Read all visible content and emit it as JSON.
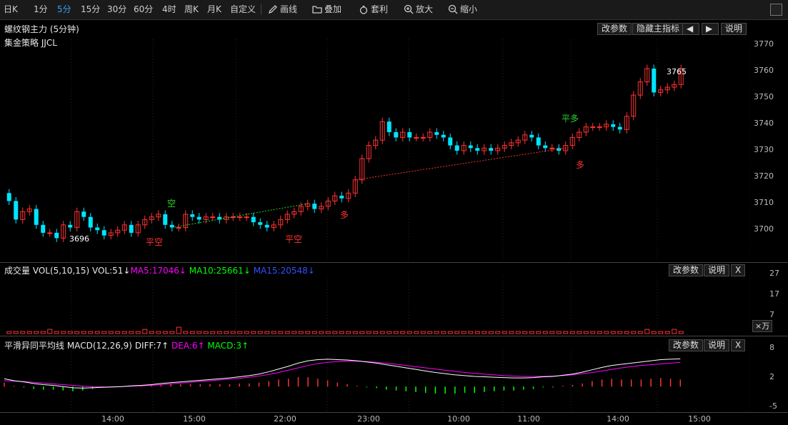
{
  "toolbar": {
    "periods": [
      "日K",
      "1分",
      "5分",
      "15分",
      "30分",
      "60分",
      "4时",
      "周K",
      "月K",
      "自定义"
    ],
    "active_period": "5分",
    "tools": [
      "画线",
      "叠加",
      "套利",
      "放大",
      "缩小"
    ]
  },
  "main_chart": {
    "title": "螺纹钢主力 (5分钟)",
    "subtitle": "集金策略 JJCL",
    "buttons": [
      "改参数",
      "隐藏主指标",
      "◀",
      "▶",
      "说明"
    ],
    "y_ticks": [
      "3770",
      "3760",
      "3750",
      "3740",
      "3730",
      "3720",
      "3710",
      "3700"
    ],
    "annotations": {
      "high": "3765",
      "low": "3696",
      "short": "空",
      "close_short_1": "平空",
      "close_short_2": "平空",
      "long_1": "多",
      "long_2": "多",
      "close_long": "平多"
    }
  },
  "volume_panel": {
    "title": "成交量",
    "indicator": "VOL(5,10,15)",
    "vol": "VOL:51↓",
    "ma5": "MA5:17046↓",
    "ma10": "MA10:25661↓",
    "ma15": "MA15:20548↓",
    "buttons": [
      "改参数",
      "说明",
      "X"
    ],
    "y_ticks": [
      "27",
      "17",
      "7"
    ],
    "unit": "×万"
  },
  "macd_panel": {
    "title": "平滑异同平均线",
    "indicator": "MACD(12,26,9)",
    "diff": "DIFF:7↑",
    "dea": "DEA:6↑",
    "macd": "MACD:3↑",
    "buttons": [
      "改参数",
      "说明",
      "X"
    ],
    "y_ticks": [
      "8",
      "2",
      "-5"
    ]
  },
  "x_axis": [
    "14:00",
    "15:00",
    "22:00",
    "23:00",
    "10:00",
    "11:00",
    "14:00",
    "15:00"
  ],
  "colors": {
    "up": "#ff3232",
    "down": "#00e5ff",
    "ma5": "#ff00ff",
    "ma10": "#00ff00",
    "ma15": "#3050ff",
    "diff": "#ffffff",
    "dea": "#ff00ff",
    "accent": "#3aa0ff"
  },
  "chart_data": {
    "type": "candlestick",
    "ylim": [
      3690,
      3772
    ],
    "closes": [
      3712,
      3705,
      3708,
      3709,
      3703,
      3700,
      3700,
      3698,
      3703,
      3702,
      3708,
      3706,
      3702,
      3701,
      3699,
      3700,
      3701,
      3703,
      3700,
      3703,
      3705,
      3706,
      3707,
      3703,
      3702,
      3702,
      3707,
      3706,
      3705,
      3706,
      3706,
      3705,
      3706,
      3706,
      3706,
      3706,
      3704,
      3703,
      3702,
      3703,
      3705,
      3707,
      3708,
      3710,
      3711,
      3709,
      3710,
      3712,
      3714,
      3713,
      3715,
      3720,
      3728,
      3733,
      3735,
      3742,
      3738,
      3736,
      3738,
      3736,
      3736,
      3736,
      3738,
      3737,
      3736,
      3733,
      3731,
      3733,
      3732,
      3731,
      3732,
      3731,
      3732,
      3733,
      3734,
      3735,
      3737,
      3736,
      3733,
      3732,
      3732,
      3731,
      3733,
      3736,
      3738,
      3740,
      3740,
      3740,
      3741,
      3740,
      3739,
      3744,
      3752,
      3757,
      3762,
      3753,
      3754,
      3755,
      3756,
      3762
    ],
    "volume_ylim": [
      0,
      27
    ],
    "volume": [
      1,
      1,
      1,
      1,
      1,
      1,
      2,
      1,
      1,
      1,
      1,
      1,
      1,
      1,
      1,
      1,
      1,
      1,
      1,
      1,
      2,
      1,
      1,
      1,
      1,
      3,
      1,
      1,
      1,
      1,
      1,
      1,
      1,
      1,
      1,
      1,
      1,
      1,
      1,
      1,
      1,
      1,
      1,
      1,
      1,
      1,
      1,
      1,
      1,
      1,
      1,
      1,
      1,
      1,
      1,
      1,
      1,
      1,
      1,
      1,
      1,
      1,
      1,
      1,
      1,
      1,
      1,
      1,
      1,
      1,
      1,
      1,
      1,
      1,
      1,
      1,
      1,
      1,
      1,
      1,
      1,
      1,
      1,
      1,
      1,
      1,
      1,
      1,
      1,
      1,
      1,
      1,
      1,
      1,
      2,
      1,
      1,
      1,
      2,
      1
    ],
    "macd_ylim": [
      -6,
      9
    ],
    "diff": [
      2,
      1.5,
      1.2,
      0.8,
      0.5,
      0.3,
      0,
      -0.3,
      -0.4,
      -0.3,
      -0.2,
      -0.1,
      0,
      0.2,
      0.3,
      0.5,
      0.8,
      1,
      1.2,
      1.4,
      1.6,
      1.8,
      2,
      2.2,
      2.5,
      2.8,
      3.2,
      3.8,
      4.5,
      5.2,
      6,
      6.6,
      6.9,
      7,
      6.9,
      6.8,
      6.6,
      6.3,
      6,
      5.6,
      5.2,
      4.8,
      4.4,
      4,
      3.6,
      3.3,
      3,
      2.8,
      2.6,
      2.5,
      2.4,
      2.3,
      2.2,
      2.2,
      2.3,
      2.5,
      2.6,
      2.9,
      3.2,
      3.7,
      4.3,
      4.9,
      5.4,
      5.7,
      6,
      6.3,
      6.6,
      6.9,
      7,
      7.1
    ],
    "dea": [
      1.5,
      1.4,
      1.3,
      1.1,
      0.9,
      0.7,
      0.5,
      0.3,
      0.1,
      0,
      -0.1,
      -0.1,
      0,
      0.1,
      0.2,
      0.3,
      0.5,
      0.7,
      0.9,
      1.1,
      1.3,
      1.5,
      1.7,
      1.9,
      2.1,
      2.4,
      2.7,
      3.1,
      3.6,
      4.2,
      4.8,
      5.4,
      5.9,
      6.2,
      6.4,
      6.5,
      6.5,
      6.4,
      6.2,
      6,
      5.7,
      5.4,
      5.1,
      4.8,
      4.5,
      4.2,
      3.9,
      3.6,
      3.4,
      3.2,
      3,
      2.8,
      2.7,
      2.6,
      2.6,
      2.6,
      2.7,
      2.8,
      3,
      3.3,
      3.6,
      4,
      4.4,
      4.8,
      5.1,
      5.4,
      5.6,
      5.8,
      6,
      6.2
    ]
  }
}
